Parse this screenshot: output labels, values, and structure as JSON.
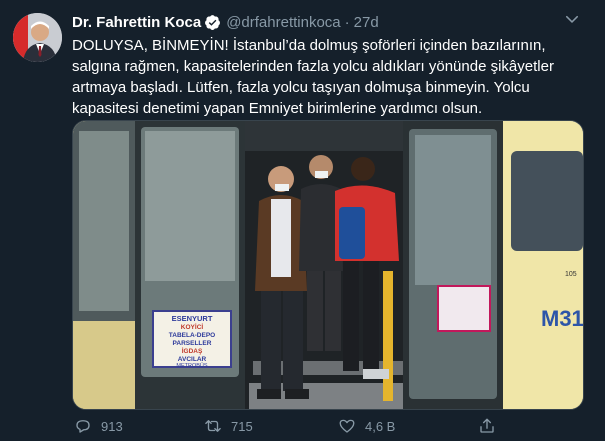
{
  "tweet": {
    "author_name": "Dr. Fahrettin Koca",
    "handle": "@drfahrettinkoca",
    "separator": "·",
    "time": "27d",
    "text": "DOLUYSA, BİNMEYİN! İstanbul’da dolmuş şoförleri içinden bazılarının, salgına rağmen, kapasitelerinden fazla yolcu aldıkları yönünde şikâyetler artmaya başladı. Lütfen, fazla yolcu taşıyan dolmuşa binmeyin. Yolcu kapasitesi denetimi yapan Emniyet birimlerine yardımcı olsun.",
    "photo": {
      "sign_lines": [
        "ESENYURT",
        "KOYİCİ",
        "TABELA-DEPO",
        "PARSELLER",
        "İGDAŞ",
        "AVCILAR",
        "METROBÜS"
      ],
      "route_code": "M31",
      "door_number": "105"
    }
  },
  "actions": {
    "replies": "913",
    "retweets": "715",
    "likes": "4,6 B",
    "share": ""
  },
  "colors": {
    "background": "#15202b",
    "secondary_text": "#8899a6",
    "verified": "#1da1f2"
  },
  "icons": {
    "verified": "verified-badge-icon",
    "caret": "chevron-down-icon",
    "reply": "reply-icon",
    "retweet": "retweet-icon",
    "like": "heart-icon",
    "share": "share-icon"
  }
}
